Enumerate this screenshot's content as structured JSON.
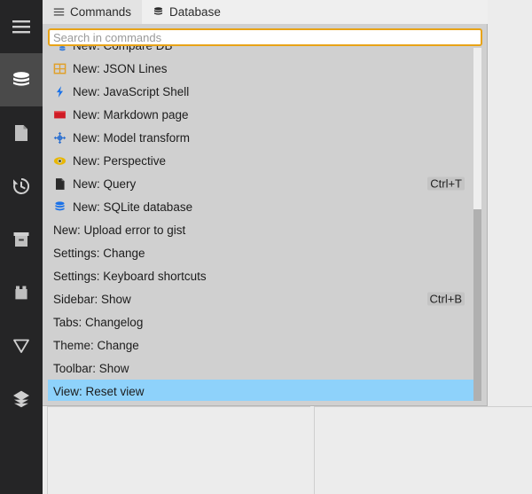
{
  "colors": {
    "activity_bar_bg": "#252526",
    "activity_active_bg": "#4a4a4a",
    "palette_bg": "#d0d0d0",
    "tabstrip_bg": "#efefef",
    "tab_active_bg": "#e3e3e3",
    "search_border": "#e8a317",
    "selection_bg": "#8ed2fb",
    "scrollbar_thumb": "#b0b0b0",
    "workspace_bg": "#ececec"
  },
  "activity_bar": {
    "items": [
      {
        "name": "menu-icon",
        "label": "Menu",
        "active": false
      },
      {
        "name": "database-icon",
        "label": "Database",
        "active": true
      },
      {
        "name": "document-icon",
        "label": "Document",
        "active": false
      },
      {
        "name": "history-icon",
        "label": "History",
        "active": false
      },
      {
        "name": "archive-icon",
        "label": "Archive",
        "active": false
      },
      {
        "name": "briefcase-icon",
        "label": "Briefcase",
        "active": false
      },
      {
        "name": "filter-icon",
        "label": "Filter",
        "active": false
      },
      {
        "name": "layers-icon",
        "label": "Layers",
        "active": false
      }
    ]
  },
  "palette": {
    "tabs": [
      {
        "label": "Commands",
        "icon": "hamburger-icon",
        "active": true
      },
      {
        "label": "Database",
        "icon": "database-icon",
        "active": false
      }
    ],
    "search": {
      "placeholder": "Search in commands",
      "value": ""
    },
    "results": [
      {
        "label": "New: Compare DB",
        "icon": "compare-db-icon",
        "shortcut": "",
        "selected": false
      },
      {
        "label": "New: JSON Lines",
        "icon": "json-lines-icon",
        "shortcut": "",
        "selected": false
      },
      {
        "label": "New: JavaScript Shell",
        "icon": "javascript-shell-icon",
        "shortcut": "",
        "selected": false
      },
      {
        "label": "New: Markdown page",
        "icon": "markdown-icon",
        "shortcut": "",
        "selected": false
      },
      {
        "label": "New: Model transform",
        "icon": "model-transform-icon",
        "shortcut": "",
        "selected": false
      },
      {
        "label": "New: Perspective",
        "icon": "perspective-icon",
        "shortcut": "",
        "selected": false
      },
      {
        "label": "New: Query",
        "icon": "query-icon",
        "shortcut": "Ctrl+T",
        "selected": false
      },
      {
        "label": "New: SQLite database",
        "icon": "sqlite-icon",
        "shortcut": "",
        "selected": false
      },
      {
        "label": "New: Upload error to gist",
        "icon": "",
        "shortcut": "",
        "selected": false
      },
      {
        "label": "Settings: Change",
        "icon": "",
        "shortcut": "",
        "selected": false
      },
      {
        "label": "Settings: Keyboard shortcuts",
        "icon": "",
        "shortcut": "",
        "selected": false
      },
      {
        "label": "Sidebar: Show",
        "icon": "",
        "shortcut": "Ctrl+B",
        "selected": false
      },
      {
        "label": "Tabs: Changelog",
        "icon": "",
        "shortcut": "",
        "selected": false
      },
      {
        "label": "Theme: Change",
        "icon": "",
        "shortcut": "",
        "selected": false
      },
      {
        "label": "Toolbar: Show",
        "icon": "",
        "shortcut": "",
        "selected": false
      },
      {
        "label": "View: Reset view",
        "icon": "",
        "shortcut": "",
        "selected": true
      }
    ]
  }
}
